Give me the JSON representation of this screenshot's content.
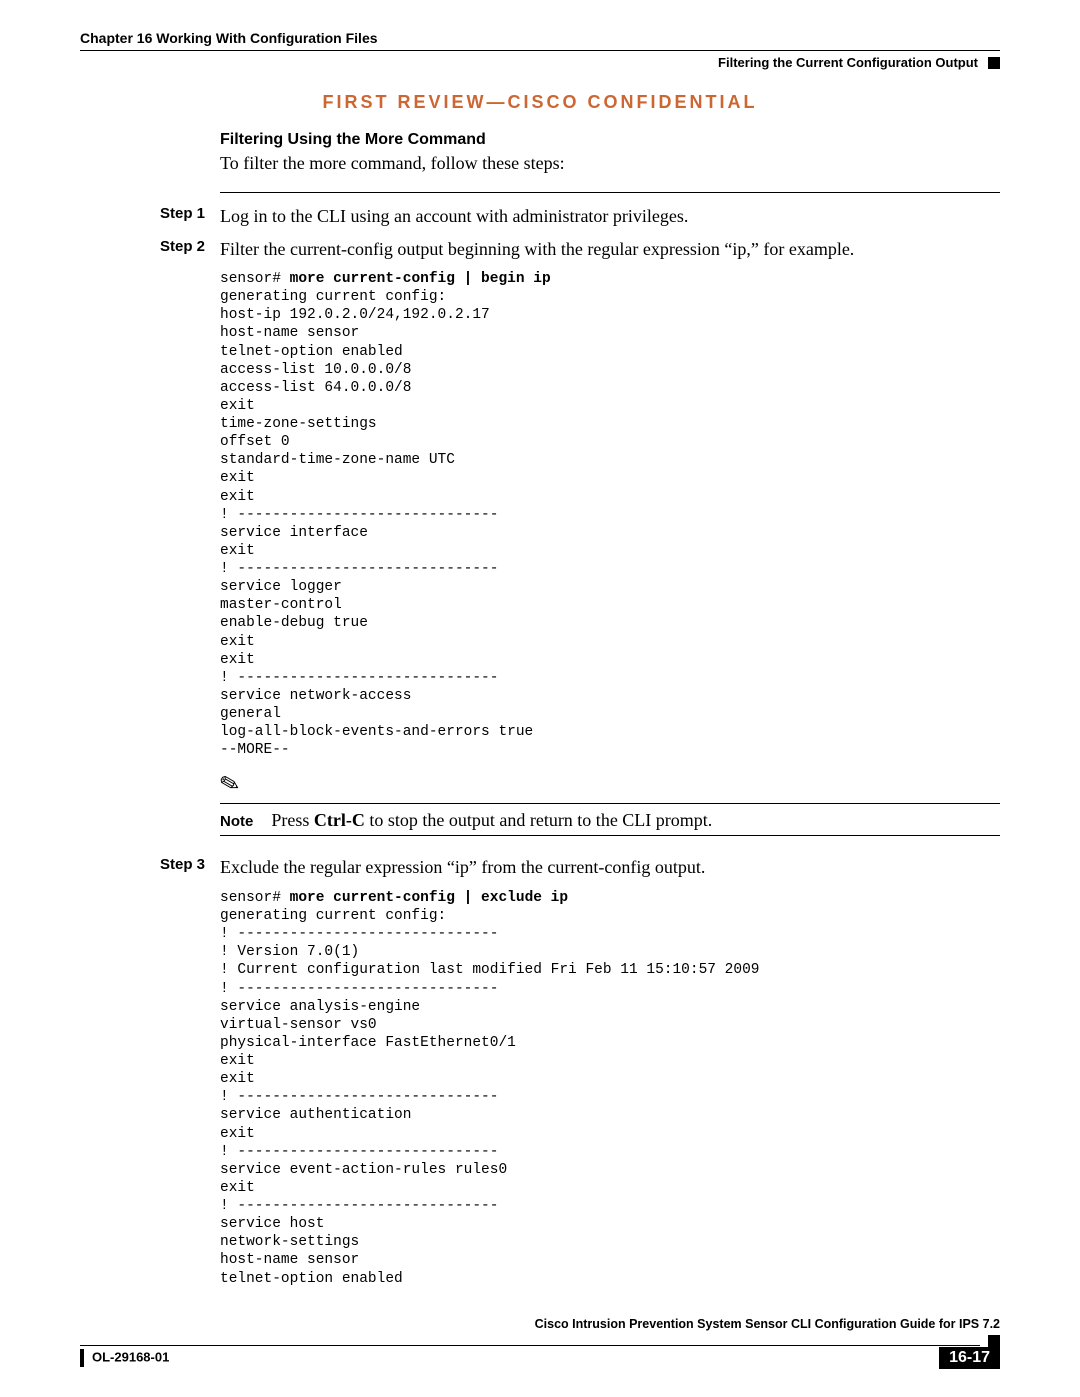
{
  "header": {
    "chapter_left": "Chapter 16    Working With Configuration Files",
    "right_text": "Filtering the Current Configuration Output"
  },
  "banner": "FIRST REVIEW—CISCO CONFIDENTIAL",
  "section": {
    "heading": "Filtering Using the More Command",
    "intro": "To filter the more command, follow these steps:"
  },
  "steps": {
    "s1": {
      "label": "Step 1",
      "text": "Log in to the CLI using an account with administrator privileges."
    },
    "s2": {
      "label": "Step 2",
      "text": "Filter the current-config output beginning with the regular expression “ip,” for example."
    },
    "s3": {
      "label": "Step 3",
      "text": "Exclude the regular expression “ip” from the current-config output."
    }
  },
  "code1": {
    "prompt": "sensor# ",
    "cmd": "more current-config | begin ip",
    "body": "generating current config:\nhost-ip 192.0.2.0/24,192.0.2.17\nhost-name sensor\ntelnet-option enabled\naccess-list 10.0.0.0/8\naccess-list 64.0.0.0/8\nexit\ntime-zone-settings\noffset 0\nstandard-time-zone-name UTC\nexit\nexit\n! ------------------------------\nservice interface\nexit\n! ------------------------------\nservice logger\nmaster-control\nenable-debug true\nexit\nexit\n! ------------------------------\nservice network-access\ngeneral\nlog-all-block-events-and-errors true\n--MORE--"
  },
  "note": {
    "label": "Note",
    "pre": "Press ",
    "key": "Ctrl-C",
    "post": " to stop the output and return to the CLI prompt."
  },
  "code2": {
    "prompt": "sensor# ",
    "cmd": "more current-config | exclude ip",
    "body": "generating current config:\n! ------------------------------\n! Version 7.0(1)\n! Current configuration last modified Fri Feb 11 15:10:57 2009\n! ------------------------------\nservice analysis-engine\nvirtual-sensor vs0\nphysical-interface FastEthernet0/1\nexit\nexit\n! ------------------------------\nservice authentication\nexit\n! ------------------------------\nservice event-action-rules rules0\nexit\n! ------------------------------\nservice host\nnetwork-settings\nhost-name sensor\ntelnet-option enabled"
  },
  "footer": {
    "guide": "Cisco Intrusion Prevention System Sensor CLI Configuration Guide for IPS 7.2",
    "doc": "OL-29168-01",
    "page": "16-17"
  }
}
